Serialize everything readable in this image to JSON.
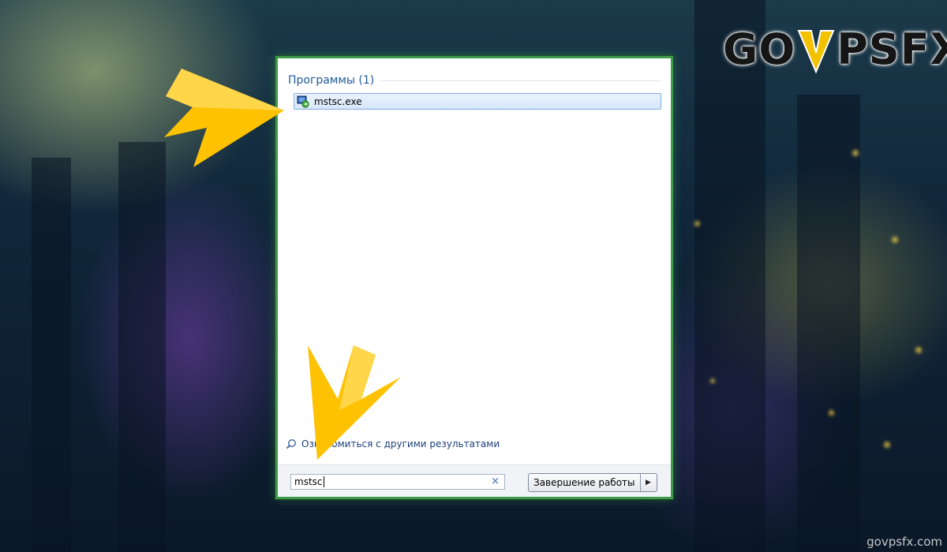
{
  "branding": {
    "logo_left": "GO",
    "logo_right": "PSFX",
    "watermark": "govpsfx.com",
    "logo_v_color": "#f2c100"
  },
  "start_menu": {
    "results_header": "Программы (1)",
    "result_items": [
      {
        "label": "mstsc.exe",
        "icon": "remote-desktop-icon"
      }
    ],
    "see_more_label": "Ознакомиться с другими результатами",
    "search": {
      "value": "mstsc",
      "clear_icon": "×"
    },
    "shutdown_label": "Завершение работы",
    "shutdown_arrow": "▶",
    "accent_color": "#3f9a4a"
  },
  "annotations": {
    "arrow_color": "#ffc200",
    "arrows": [
      "arrow-pointing-right",
      "arrow-pointing-down"
    ]
  }
}
